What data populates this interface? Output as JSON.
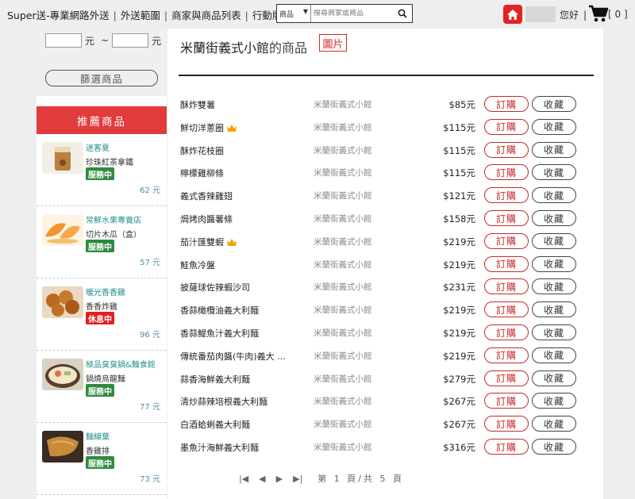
{
  "header": {
    "nav": [
      "Super送-專業網路外送",
      "外送範圍",
      "商家與商品列表",
      "行動版"
    ],
    "search": {
      "category": "商品",
      "placeholder": "搜尋商家或商品"
    },
    "greeting": "您好",
    "cart_count": "[ 0 ]"
  },
  "sidebar": {
    "price_unit": "元",
    "price_sep": "~",
    "filter_button": "篩選商品",
    "recommend_title": "推薦商品",
    "stores": [
      {
        "name": "迷客夏",
        "item": "珍珠紅茶拿鐵",
        "status": "服務中",
        "open": true,
        "fee": "62 元",
        "thumb": "drink-image"
      },
      {
        "name": "常鮮水果專賣店",
        "item": "切片木瓜（盒）",
        "status": "服務中",
        "open": true,
        "fee": "57 元",
        "thumb": "papaya-image"
      },
      {
        "name": "暖光香香雞",
        "item": "香香炸雞",
        "status": "休息中",
        "open": false,
        "fee": "96 元",
        "thumb": "fried-chicken-image"
      },
      {
        "name": "極品臭臭鍋&麵食館",
        "item": "鍋燒烏龍麵",
        "status": "服務中",
        "open": true,
        "fee": "77 元",
        "thumb": "udon-image"
      },
      {
        "name": "麵線葉",
        "item": "香雞排",
        "status": "服務中",
        "open": true,
        "fee": "73 元",
        "thumb": "chicken-chop-image"
      }
    ]
  },
  "main": {
    "shop_name": "米蘭街義式小館",
    "title_suffix": "的商品",
    "picture_button": "圖片",
    "order_label": "訂購",
    "fav_label": "收藏",
    "products": [
      {
        "name": "酥炸雙薯",
        "shop": "米蘭街義式小館",
        "price": "$85元",
        "crown": false
      },
      {
        "name": "鮮切洋蔥圈",
        "shop": "米蘭街義式小館",
        "price": "$115元",
        "crown": true
      },
      {
        "name": "酥炸花枝圈",
        "shop": "米蘭街義式小館",
        "price": "$115元",
        "crown": false
      },
      {
        "name": "檸檬雞柳條",
        "shop": "米蘭街義式小館",
        "price": "$115元",
        "crown": false
      },
      {
        "name": "義式香辣雞翅",
        "shop": "米蘭街義式小館",
        "price": "$121元",
        "crown": false
      },
      {
        "name": "焗烤肉醬薯條",
        "shop": "米蘭街義式小館",
        "price": "$158元",
        "crown": false
      },
      {
        "name": "茄汁匯雙蝦",
        "shop": "米蘭街義式小館",
        "price": "$219元",
        "crown": true
      },
      {
        "name": "鮭魚冷盤",
        "shop": "米蘭街義式小館",
        "price": "$219元",
        "crown": false
      },
      {
        "name": "披薩球佐辣蝦沙司",
        "shop": "米蘭街義式小館",
        "price": "$231元",
        "crown": false
      },
      {
        "name": "香蒜橄欖油義大利麵",
        "shop": "米蘭街義式小館",
        "price": "$219元",
        "crown": false
      },
      {
        "name": "香蒜鯷魚汁義大利麵",
        "shop": "米蘭街義式小館",
        "price": "$219元",
        "crown": false
      },
      {
        "name": "傳統番茄肉醬(牛肉)義大 ...",
        "shop": "米蘭街義式小館",
        "price": "$219元",
        "crown": false
      },
      {
        "name": "蒜香海鮮義大利麵",
        "shop": "米蘭街義式小館",
        "price": "$279元",
        "crown": false
      },
      {
        "name": "清炒蒜辣培根義大利麵",
        "shop": "米蘭街義式小館",
        "price": "$267元",
        "crown": false
      },
      {
        "name": "白酒蛤蜊義大利麵",
        "shop": "米蘭街義式小館",
        "price": "$267元",
        "crown": false
      },
      {
        "name": "墨魚汁海鮮義大利麵",
        "shop": "米蘭街義式小館",
        "price": "$316元",
        "crown": false
      }
    ],
    "pager": {
      "first": "|◀",
      "prev": "◀",
      "next": "▶",
      "last": "▶|",
      "info": "第 1 頁/共 5 頁"
    }
  }
}
